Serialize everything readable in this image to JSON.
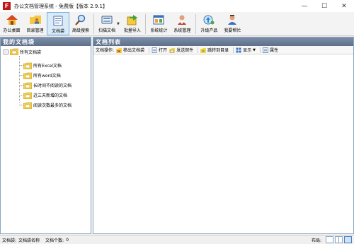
{
  "window": {
    "app_icon_glyph": "F",
    "title": "办公文档管理系统 - 免费版【版本 2.9.1】",
    "controls": [
      "—",
      "☐",
      "✕"
    ]
  },
  "toolbar": {
    "buttons": [
      {
        "label": "办公桌面",
        "icon": "home-icon"
      },
      {
        "label": "目录管理",
        "icon": "folder-users-icon"
      },
      {
        "label": "文档袋",
        "icon": "document-bag-icon",
        "active": true
      },
      {
        "label": "高级搜索",
        "icon": "magnifier-icon"
      },
      {
        "label": "扫描文档",
        "icon": "scanner-icon"
      },
      {
        "label": "批量导入",
        "icon": "import-icon"
      },
      {
        "label": "系统统计",
        "icon": "statistics-icon"
      },
      {
        "label": "系统管理",
        "icon": "user-admin-icon"
      },
      {
        "label": "升级产品",
        "icon": "upgrade-icon"
      },
      {
        "label": "我要帮忙",
        "icon": "help-user-icon"
      }
    ]
  },
  "left_panel": {
    "title": "我的文档袋",
    "tree": {
      "root_label": "所有文档袋",
      "expander": "-",
      "items": [
        "所有Excel文档",
        "所有word文档",
        "长时间不阅读的文档",
        "近三天新增的文档",
        "阅读次数最多的文档"
      ]
    }
  },
  "right_panel": {
    "title": "文档列表",
    "doc_toolbar": {
      "prefix": "文档操作:",
      "remove": "移出文档袋",
      "open": "打开",
      "send_email": "发送邮件",
      "goto_dir": "跳转到目录",
      "display": "显示",
      "properties": "属性"
    }
  },
  "statusbar": {
    "bag_label": "文档袋:",
    "bag_name": "文档袋名称",
    "count_label": "文档个数:",
    "count_value": "0",
    "layout_label": "布局:"
  },
  "colors": {
    "panel_header": "#6a7c96",
    "active_tab": "#d9ebf9",
    "folder_yellow": "#f5d24a"
  }
}
